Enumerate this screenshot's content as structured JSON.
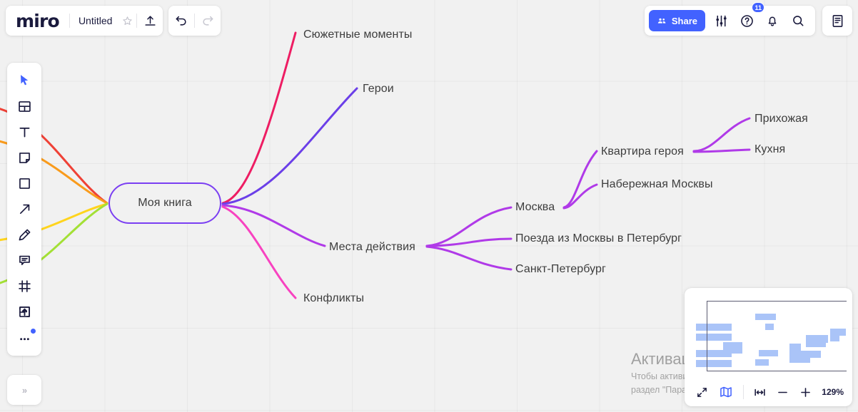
{
  "app": {
    "logo": "miro",
    "document_title": "Untitled"
  },
  "topbar_left": {
    "star_icon": "star-icon",
    "upload_icon": "upload-icon",
    "undo_icon": "undo-icon",
    "redo_icon": "redo-icon"
  },
  "topbar_right": {
    "share_label": "Share",
    "share_icon": "people-icon",
    "share_color": "#4262ff",
    "settings_icon": "sliders-icon",
    "help_icon": "question-circle-icon",
    "help_badge": "11",
    "notifications_icon": "bell-icon",
    "search_icon": "search-icon",
    "notes_icon": "document-icon"
  },
  "tool_rail": {
    "items": [
      {
        "name": "cursor-tool",
        "icon": "cursor-icon",
        "selected": true
      },
      {
        "name": "templates-tool",
        "icon": "templates-icon",
        "selected": false
      },
      {
        "name": "text-tool",
        "icon": "text-icon",
        "selected": false
      },
      {
        "name": "sticky-note-tool",
        "icon": "sticky-note-icon",
        "selected": false
      },
      {
        "name": "shape-tool",
        "icon": "square-icon",
        "selected": false
      },
      {
        "name": "arrow-tool",
        "icon": "arrow-icon",
        "selected": false
      },
      {
        "name": "pen-tool",
        "icon": "pen-icon",
        "selected": false
      },
      {
        "name": "comment-tool",
        "icon": "comment-icon",
        "selected": false
      },
      {
        "name": "frame-tool",
        "icon": "frame-icon",
        "selected": false
      },
      {
        "name": "upload-tool",
        "icon": "upload-box-icon",
        "selected": false
      },
      {
        "name": "more-tools",
        "icon": "ellipsis-icon",
        "selected": false
      }
    ],
    "collapse_label": "»"
  },
  "mindmap": {
    "center": {
      "label": "Моя книга",
      "border_color": "#7b3ff2"
    },
    "right_branches": [
      {
        "label": "Сюжетные моменты",
        "color": "#ee1d63"
      },
      {
        "label": "Герои",
        "color": "#6b3fe8"
      },
      {
        "label": "Места действия",
        "color": "#b03ae8"
      },
      {
        "label": "Конфликты",
        "color": "#f842c0"
      }
    ],
    "places_children": [
      {
        "label": "Москва",
        "color": "#b03ae8"
      },
      {
        "label": "Поезда из Москвы в Петербург",
        "color": "#b03ae8"
      },
      {
        "label": "Санкт-Петербург",
        "color": "#b03ae8"
      }
    ],
    "moscow_children": [
      {
        "label": "Квартира героя",
        "color": "#b03ae8"
      },
      {
        "label": "Набережная Москвы",
        "color": "#b03ae8"
      }
    ],
    "apartment_children": [
      {
        "label": "Прихожая",
        "color": "#b03ae8"
      },
      {
        "label": "Кухня",
        "color": "#b03ae8"
      }
    ],
    "left_branch_colors": [
      "#ef4136",
      "#f99b1c",
      "#ffd41d",
      "#a3e035"
    ]
  },
  "minimap": {
    "map_icon": "map-icon",
    "fullscreen_icon": "fullscreen-icon",
    "fit_icon": "fit-to-screen-icon",
    "zoom_out_icon": "minus-icon",
    "zoom_in_icon": "plus-icon",
    "zoom_level": "129%"
  },
  "watermark": {
    "title": "Активация Windows",
    "line1": "Чтобы активировать Windows, перейдите в",
    "line2": "раздел \"Параметры\"."
  }
}
